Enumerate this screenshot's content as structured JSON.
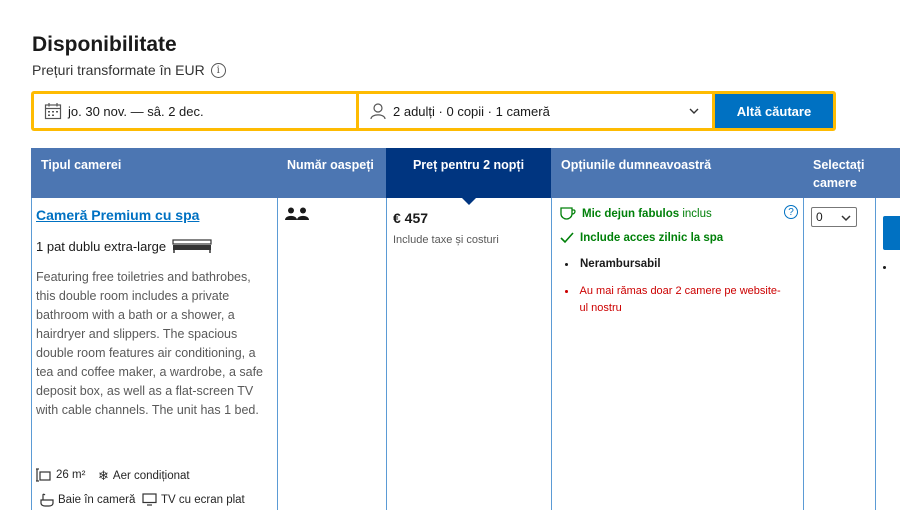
{
  "heading": {
    "title": "Disponibilitate",
    "subtitle": "Prețuri transformate în EUR"
  },
  "search": {
    "dates_label": "jo. 30 nov. — sâ. 2 dec.",
    "guests_label": "2 adulți · 0 copii · 1 cameră",
    "button_label": "Altă căutare"
  },
  "table_headers": {
    "room_type": "Tipul camerei",
    "guests": "Număr oaspeți",
    "price": "Preț pentru 2 nopți",
    "options": "Opțiunile dumneavoastră",
    "select_rooms": "Selectați camere"
  },
  "room": {
    "name": "Cameră Premium cu spa",
    "bed": "1 pat dublu extra-large",
    "description": "Featuring free toiletries and bathrobes, this double room includes a private bathroom with a bath or a shower, a hairdryer and slippers. The spacious double room features air conditioning, a tea and coffee maker, a wardrobe, a safe deposit box, as well as a flat-screen TV with cable channels. The unit has 1 bed.",
    "facilities": {
      "size": "26 m²",
      "aircon": "Aer condiționat",
      "bath": "Baie în cameră",
      "tv": "TV cu ecran plat"
    },
    "guests_count": 2
  },
  "price": {
    "amount": "€ 457",
    "note": "Include taxe și costuri"
  },
  "options": {
    "breakfast_bold": "Mic dejun fabulos",
    "breakfast_rest": "inclus",
    "spa": "Include acces zilnic la spa",
    "refund": "Nerambursabil",
    "scarcity": "Au mai rămas doar 2 camere pe website-ul nostru"
  },
  "room_select": {
    "value": "0"
  },
  "colors": {
    "accent_blue": "#0071c2",
    "header_blue": "#4c76b2",
    "header_active": "#003580",
    "search_border": "#febb02",
    "green": "#008009",
    "red": "#cc0000"
  }
}
